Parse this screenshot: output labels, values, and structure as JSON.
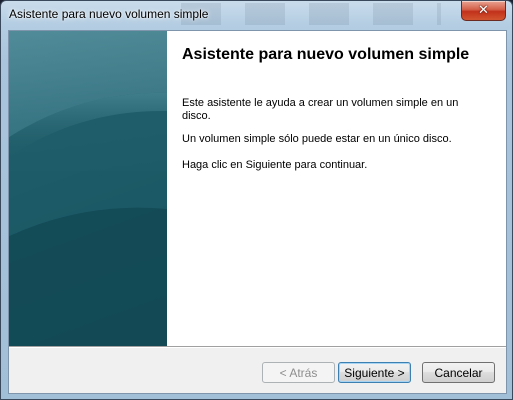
{
  "window": {
    "title": "Asistente para nuevo volumen simple",
    "close_glyph": "✕"
  },
  "content": {
    "heading": "Asistente para nuevo volumen simple",
    "paragraphs": [
      "Este asistente le ayuda a crear un volumen simple en un disco.",
      "Un volumen simple sólo puede estar en un único disco.",
      "Haga clic en Siguiente para continuar."
    ]
  },
  "buttons": {
    "back": "< Atrás",
    "next": "Siguiente >",
    "cancel": "Cancelar"
  },
  "colors": {
    "side_panel": "#1f5f6c",
    "close_button": "#c2311b",
    "default_button_border": "#3c7fb1"
  },
  "icons": {
    "close": "close-icon"
  }
}
